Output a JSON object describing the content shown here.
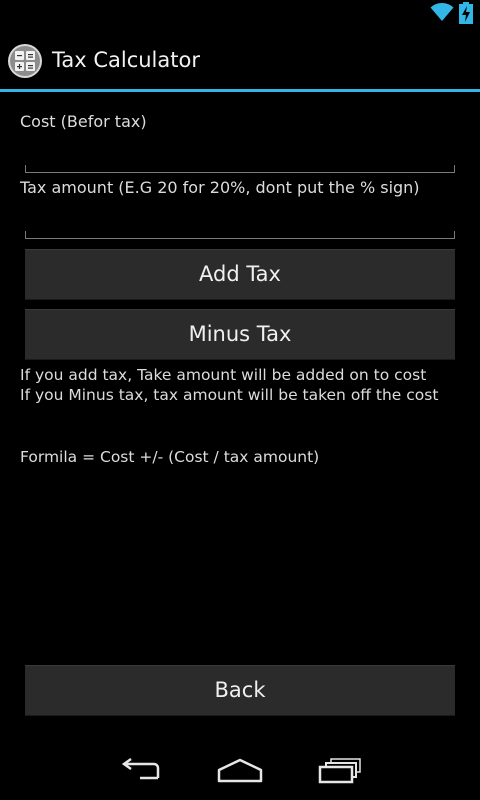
{
  "app": {
    "title": "Tax Calculator"
  },
  "form": {
    "cost_label": "Cost (Befor tax)",
    "cost_value": "",
    "tax_label": "Tax amount (E.G 20 for 20%, dont put the % sign)",
    "tax_value": ""
  },
  "buttons": {
    "add_tax": "Add Tax",
    "minus_tax": "Minus Tax",
    "back": "Back"
  },
  "info": {
    "line1": "If you add tax, Take amount will be added on to cost",
    "line2": "If you Minus tax, tax amount will be taken off the cost",
    "formula": "Formila = Cost +/- (Cost / tax amount)"
  },
  "icons": {
    "wifi": "wifi-icon",
    "battery": "battery-charging-icon",
    "app": "calculator-icon",
    "back": "back-icon",
    "home": "home-icon",
    "recents": "recent-apps-icon"
  },
  "colors": {
    "accent": "#33b5e5",
    "button_bg": "#2b2b2b",
    "background": "#000000"
  }
}
